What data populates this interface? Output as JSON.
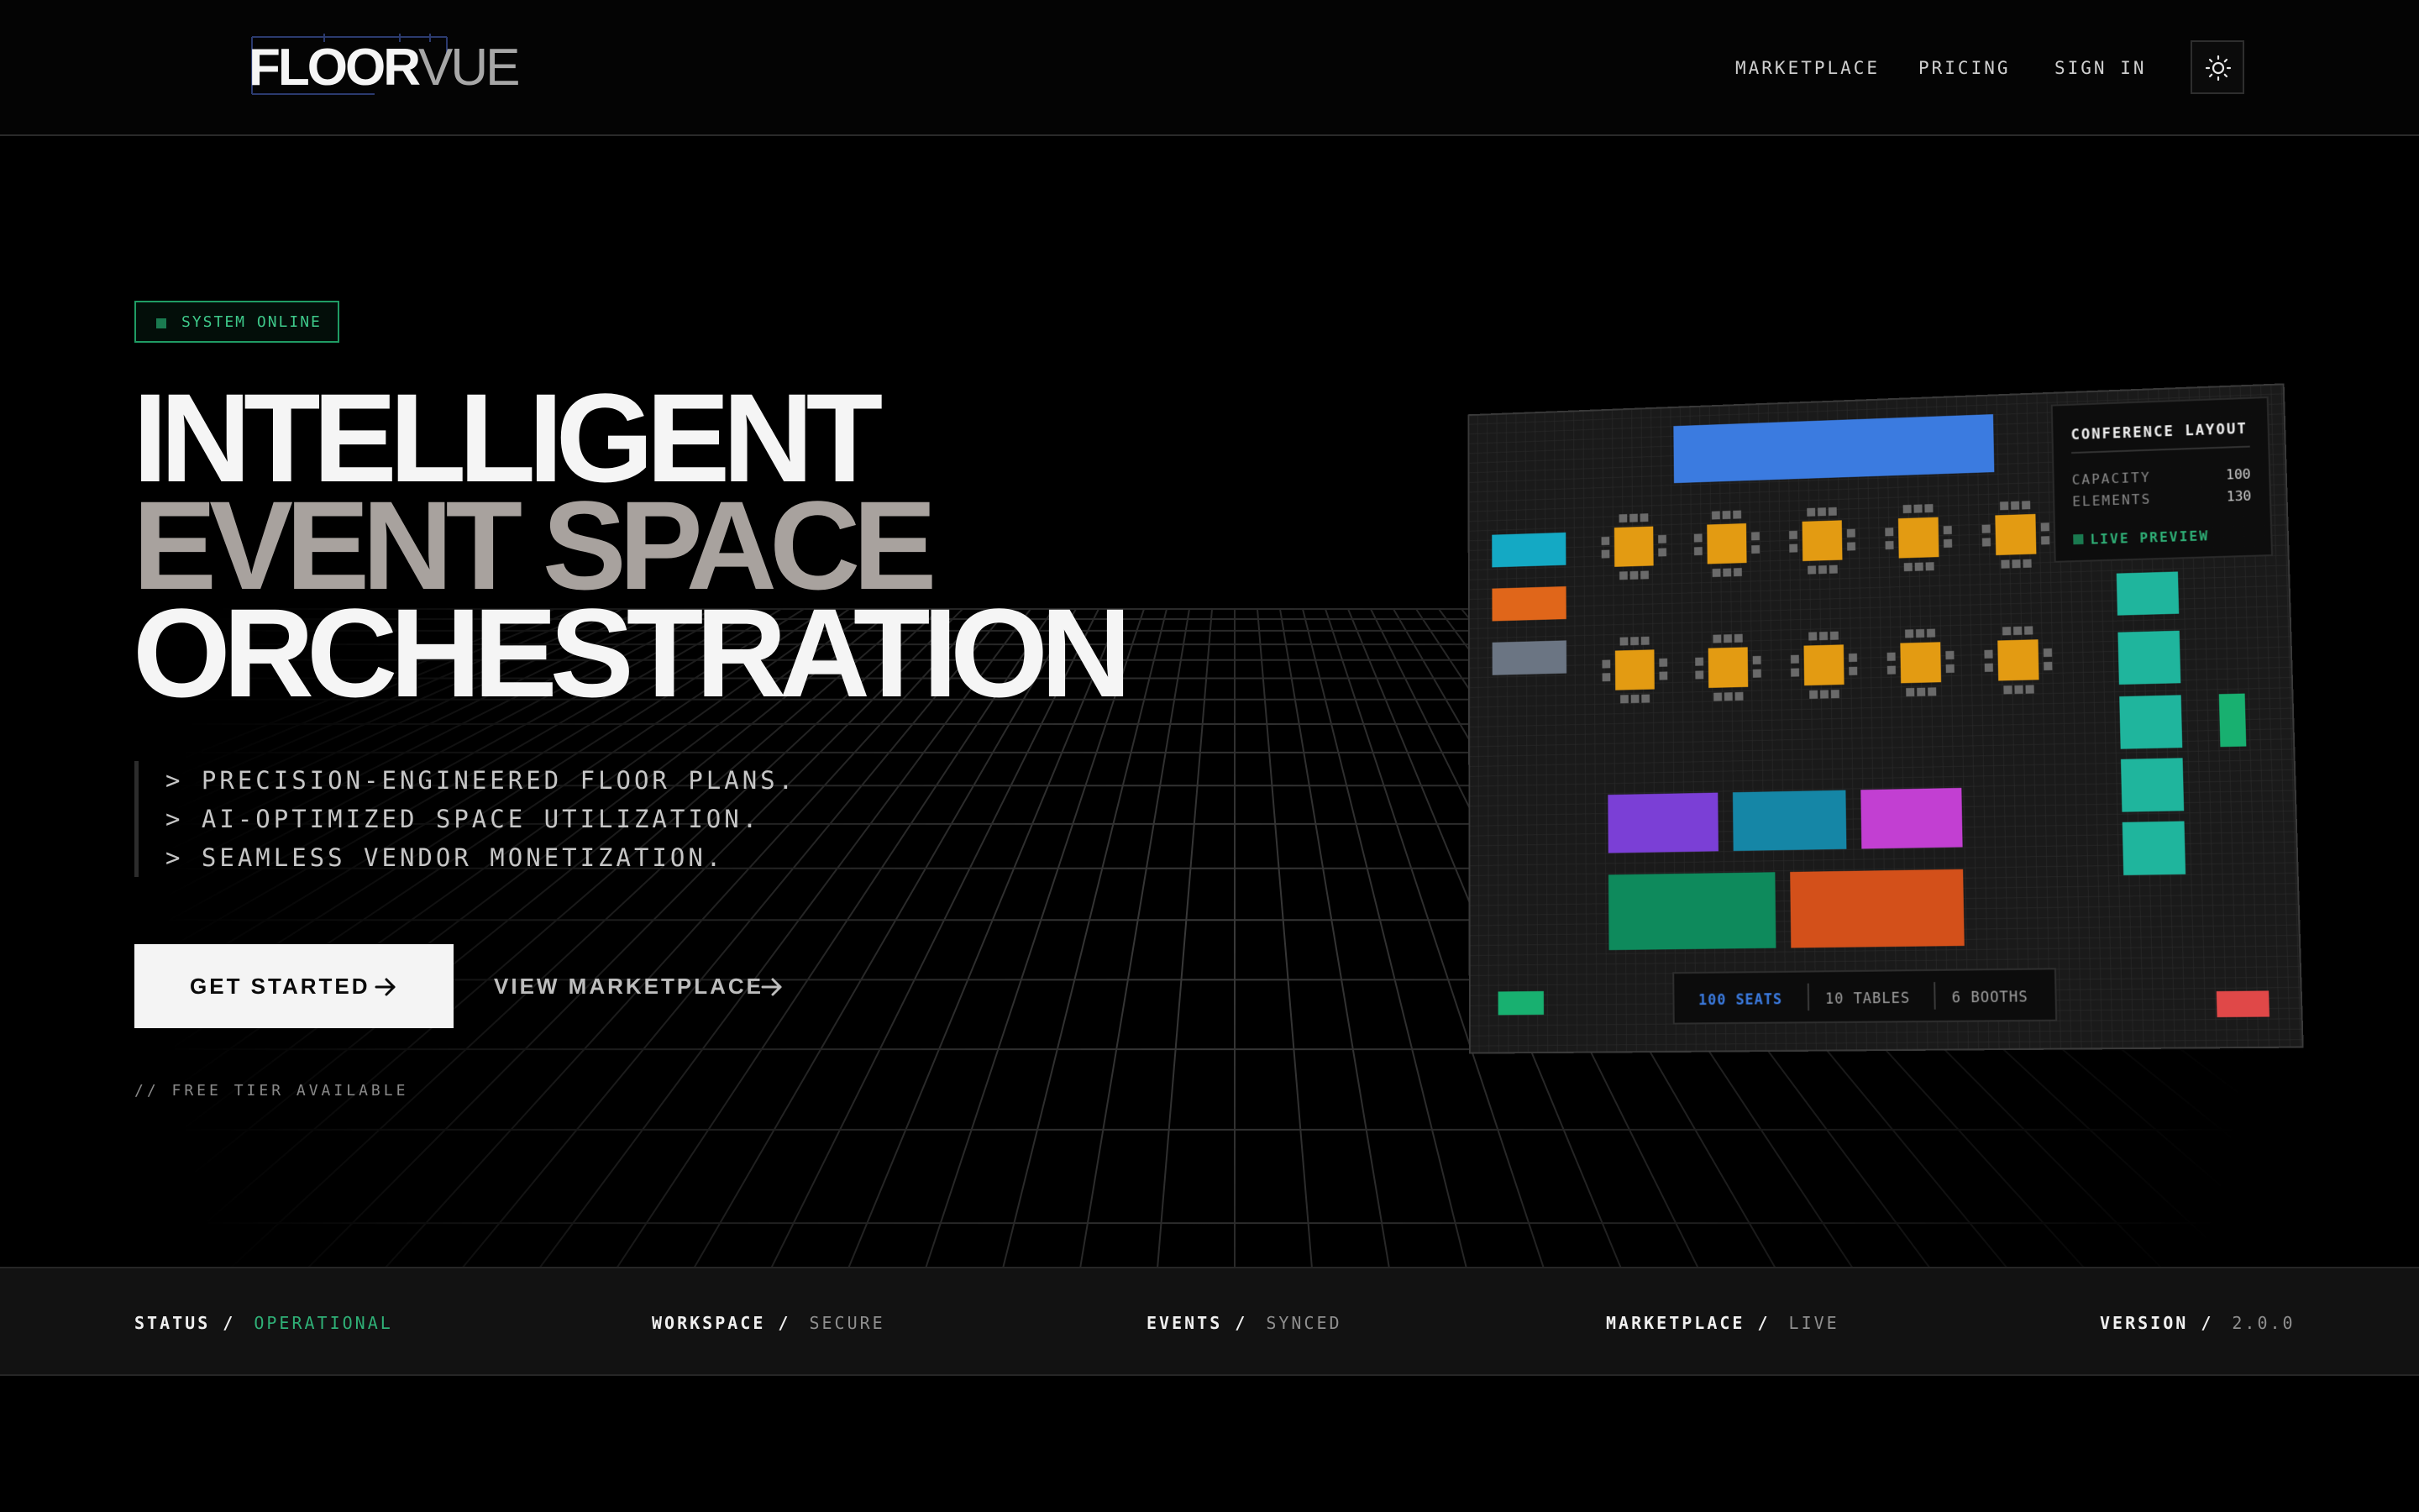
{
  "brand": {
    "logo_strong": "FLOOR",
    "logo_light": "VUE"
  },
  "nav": {
    "items": [
      {
        "label": "MARKETPLACE"
      },
      {
        "label": "PRICING"
      },
      {
        "label": "SIGN IN"
      }
    ],
    "theme_toggle_icon": "sun-icon"
  },
  "hero": {
    "badge": "SYSTEM ONLINE",
    "headline": [
      "INTELLIGENT",
      "EVENT SPACE",
      "ORCHESTRATION"
    ],
    "bullets": [
      "> PRECISION-ENGINEERED FLOOR PLANS.",
      "> AI-OPTIMIZED SPACE UTILIZATION.",
      "> SEAMLESS VENDOR MONETIZATION."
    ],
    "primary_cta": "GET STARTED",
    "secondary_cta": "VIEW MARKETPLACE",
    "footnote": "// FREE TIER AVAILABLE"
  },
  "preview": {
    "panel_title": "CONFERENCE LAYOUT",
    "stats": [
      {
        "label": "CAPACITY",
        "value": "100"
      },
      {
        "label": "ELEMENTS",
        "value": "130"
      }
    ],
    "live_label": "LIVE PREVIEW",
    "footer_stats": [
      "100 SEATS",
      "10 TABLES",
      "6 BOOTHS"
    ]
  },
  "status_bar": [
    {
      "key": "STATUS /",
      "value": "OPERATIONAL"
    },
    {
      "key": "WORKSPACE /",
      "value": "SECURE"
    },
    {
      "key": "EVENTS /",
      "value": "SYNCED"
    },
    {
      "key": "MARKETPLACE /",
      "value": "LIVE"
    },
    {
      "key": "VERSION /",
      "value": "2.0.0"
    }
  ],
  "colors": {
    "background": "#000000",
    "accent_green": "#2fb077",
    "stage_blue": "#3b7be0",
    "table_orange": "#e39b12",
    "booth_teal": "#1fb59d",
    "muted_headline": "#a8a29e"
  }
}
